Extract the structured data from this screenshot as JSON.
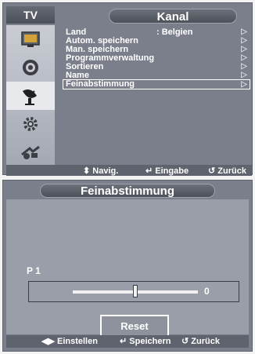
{
  "menu": {
    "tv_label": "TV",
    "title": "Kanal",
    "items": [
      {
        "label": "Land",
        "value": ": Belgien",
        "arrow": "▷"
      },
      {
        "label": "Autom. speichern",
        "value": "",
        "arrow": "▷"
      },
      {
        "label": "Man. speichern",
        "value": "",
        "arrow": "▷"
      },
      {
        "label": "Programmverwaltung",
        "value": "",
        "arrow": "▷"
      },
      {
        "label": "Sortieren",
        "value": "",
        "arrow": "▷"
      },
      {
        "label": "Name",
        "value": "",
        "arrow": "▷"
      },
      {
        "label": "Feinabstimmung",
        "value": "",
        "arrow": "▷"
      }
    ],
    "selected_index": 6,
    "sidebar_icons": [
      "picture-icon",
      "sound-icon",
      "channel-icon",
      "setup-icon",
      "input-icon"
    ],
    "footer": {
      "navig_symbol": "⬍",
      "navig": "Navig.",
      "enter_symbol": "↵",
      "enter": "Eingabe",
      "back_symbol": "↺",
      "back": "Zurück"
    }
  },
  "fine_tune": {
    "title": "Feinabstimmung",
    "channel": "P 1",
    "slider": {
      "value": "0",
      "min": -50,
      "max": 50,
      "position": 0.5
    },
    "reset_label": "Reset",
    "footer": {
      "adjust_symbol": "◀▶",
      "adjust": "Einstellen",
      "save_symbol": "↵",
      "save": "Speichern",
      "back_symbol": "↺",
      "back": "Zurück"
    }
  },
  "colors": {
    "panel": "#7b7f8c",
    "footer": "#5f636d",
    "sidebar": "#b7bac2",
    "text": "#ffffff"
  }
}
